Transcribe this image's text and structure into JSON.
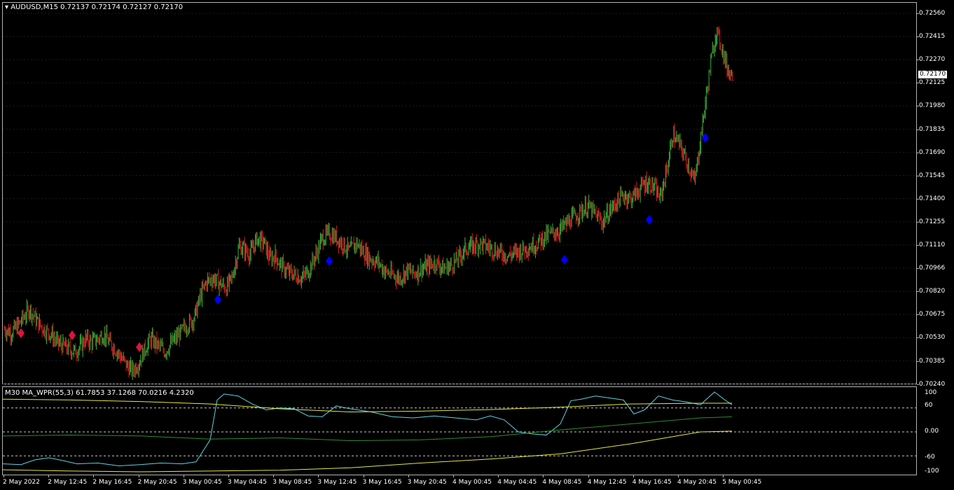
{
  "header": {
    "symbol_line": "AUDUSD,M15  0.72137 0.72174 0.72127 0.72170",
    "indicator_line": "M30 MA_WPR(55,3) 61.7853 37.1268 70.0216 4.2320"
  },
  "price_axis": [
    "0.72560",
    "0.72415",
    "0.72270",
    "0.72125",
    "0.71980",
    "0.71835",
    "0.71690",
    "0.71545",
    "0.71400",
    "0.71255",
    "0.71110",
    "0.70966",
    "0.70820",
    "0.70675",
    "0.70530",
    "0.70385",
    "0.70240"
  ],
  "current_price": "0.72170",
  "indicator_axis": [
    "100",
    "60",
    "0.00",
    "-60",
    "-100"
  ],
  "time_axis": [
    "2 May 2022",
    "2 May 12:45",
    "2 May 16:45",
    "2 May 20:45",
    "3 May 00:45",
    "3 May 04:45",
    "3 May 08:45",
    "3 May 12:45",
    "3 May 16:45",
    "3 May 20:45",
    "4 May 00:45",
    "4 May 04:45",
    "4 May 08:45",
    "4 May 12:45",
    "4 May 16:45",
    "4 May 20:45",
    "5 May 00:45"
  ],
  "colors": {
    "background": "#000000",
    "bull_candle": "#3cb43c",
    "bear_candle": "#dc1e1e",
    "sell_marker": "#dc143c",
    "buy_marker": "#0000ff",
    "wpr_line": "#5fd3e6",
    "ma_yellow": "#e6e64a",
    "ma_green": "#2e8b2e"
  },
  "chart_data": {
    "type": "candlestick",
    "symbol": "AUDUSD",
    "timeframe": "M15",
    "ylim": [
      0.7024,
      0.7256
    ],
    "close_path": [
      [
        0,
        0.7058
      ],
      [
        8,
        0.7056
      ],
      [
        16,
        0.7061
      ],
      [
        22,
        0.7066
      ],
      [
        28,
        0.7071
      ],
      [
        36,
        0.7063
      ],
      [
        44,
        0.7058
      ],
      [
        52,
        0.7055
      ],
      [
        58,
        0.705
      ],
      [
        64,
        0.7048
      ],
      [
        70,
        0.7046
      ],
      [
        78,
        0.7044
      ],
      [
        84,
        0.7047
      ],
      [
        90,
        0.7052
      ],
      [
        96,
        0.705
      ],
      [
        104,
        0.7052
      ],
      [
        110,
        0.7055
      ],
      [
        116,
        0.705
      ],
      [
        124,
        0.7045
      ],
      [
        130,
        0.704
      ],
      [
        136,
        0.7035
      ],
      [
        142,
        0.7032
      ],
      [
        150,
        0.7038
      ],
      [
        156,
        0.7046
      ],
      [
        162,
        0.7052
      ],
      [
        170,
        0.7048
      ],
      [
        178,
        0.7044
      ],
      [
        186,
        0.705
      ],
      [
        194,
        0.7055
      ],
      [
        200,
        0.7059
      ],
      [
        210,
        0.7065
      ],
      [
        218,
        0.708
      ],
      [
        224,
        0.7088
      ],
      [
        232,
        0.709
      ],
      [
        240,
        0.7086
      ],
      [
        246,
        0.7084
      ],
      [
        252,
        0.709
      ],
      [
        260,
        0.711
      ],
      [
        266,
        0.7108
      ],
      [
        272,
        0.7105
      ],
      [
        280,
        0.7115
      ],
      [
        288,
        0.7112
      ],
      [
        294,
        0.7102
      ],
      [
        300,
        0.7104
      ],
      [
        306,
        0.7098
      ],
      [
        314,
        0.7094
      ],
      [
        322,
        0.7092
      ],
      [
        330,
        0.709
      ],
      [
        338,
        0.7096
      ],
      [
        346,
        0.7106
      ],
      [
        352,
        0.7115
      ],
      [
        360,
        0.7118
      ],
      [
        366,
        0.7116
      ],
      [
        374,
        0.7112
      ],
      [
        382,
        0.7107
      ],
      [
        390,
        0.7112
      ],
      [
        398,
        0.7106
      ],
      [
        406,
        0.7102
      ],
      [
        414,
        0.71
      ],
      [
        422,
        0.7094
      ],
      [
        430,
        0.7092
      ],
      [
        438,
        0.709
      ],
      [
        446,
        0.7095
      ],
      [
        454,
        0.7093
      ],
      [
        462,
        0.7096
      ],
      [
        470,
        0.7098
      ],
      [
        478,
        0.71
      ],
      [
        486,
        0.7096
      ],
      [
        494,
        0.7098
      ],
      [
        502,
        0.7102
      ],
      [
        510,
        0.7108
      ],
      [
        518,
        0.711
      ],
      [
        526,
        0.7112
      ],
      [
        534,
        0.711
      ],
      [
        542,
        0.7108
      ],
      [
        550,
        0.7106
      ],
      [
        558,
        0.7104
      ],
      [
        566,
        0.7106
      ],
      [
        574,
        0.7108
      ],
      [
        582,
        0.711
      ],
      [
        590,
        0.7112
      ],
      [
        598,
        0.7116
      ],
      [
        606,
        0.7118
      ],
      [
        614,
        0.712
      ],
      [
        622,
        0.7124
      ],
      [
        630,
        0.7128
      ],
      [
        638,
        0.7132
      ],
      [
        646,
        0.7135
      ],
      [
        654,
        0.713
      ],
      [
        662,
        0.7125
      ],
      [
        670,
        0.7132
      ],
      [
        678,
        0.7138
      ],
      [
        686,
        0.7142
      ],
      [
        694,
        0.714
      ],
      [
        702,
        0.7145
      ],
      [
        710,
        0.715
      ],
      [
        718,
        0.7148
      ],
      [
        726,
        0.714
      ],
      [
        734,
        0.716
      ],
      [
        740,
        0.718
      ],
      [
        746,
        0.7175
      ],
      [
        752,
        0.7168
      ],
      [
        758,
        0.716
      ],
      [
        764,
        0.715
      ],
      [
        770,
        0.7175
      ],
      [
        776,
        0.72
      ],
      [
        782,
        0.7225
      ],
      [
        788,
        0.7245
      ],
      [
        794,
        0.7235
      ],
      [
        800,
        0.7222
      ],
      [
        806,
        0.7217
      ]
    ],
    "sell_signals_at_step": [
      3,
      12,
      24
    ],
    "buy_signals_at_step": [
      37,
      58,
      100,
      116,
      130
    ],
    "indicator": {
      "name": "MA_WPR(55,3)",
      "timeframe": "M30",
      "values": [
        61.7853,
        37.1268,
        70.0216,
        4.232
      ],
      "levels": [
        60,
        0,
        -60
      ],
      "ylim": [
        -100,
        100
      ]
    }
  }
}
